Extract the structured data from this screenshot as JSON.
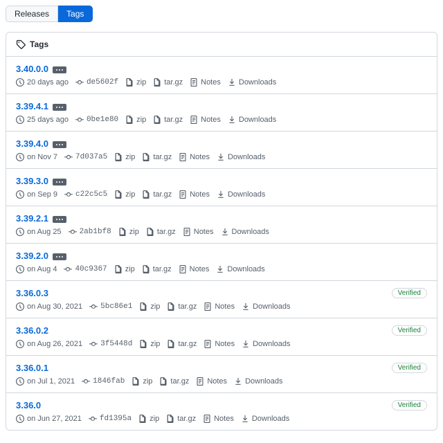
{
  "tabs": {
    "releases": "Releases",
    "tags": "Tags"
  },
  "panel_title": "Tags",
  "labels": {
    "zip": "zip",
    "targz": "tar.gz",
    "notes": "Notes",
    "downloads": "Downloads",
    "verified": "Verified"
  },
  "tags": [
    {
      "name": "3.40.0.0",
      "date": "20 days ago",
      "commit": "de5602f",
      "ellipsis": true,
      "verified": false
    },
    {
      "name": "3.39.4.1",
      "date": "25 days ago",
      "commit": "0be1e80",
      "ellipsis": true,
      "verified": false
    },
    {
      "name": "3.39.4.0",
      "date": "on Nov 7",
      "commit": "7d037a5",
      "ellipsis": true,
      "verified": false
    },
    {
      "name": "3.39.3.0",
      "date": "on Sep 9",
      "commit": "c22c5c5",
      "ellipsis": true,
      "verified": false
    },
    {
      "name": "3.39.2.1",
      "date": "on Aug 25",
      "commit": "2ab1bf8",
      "ellipsis": true,
      "verified": false
    },
    {
      "name": "3.39.2.0",
      "date": "on Aug 4",
      "commit": "40c9367",
      "ellipsis": true,
      "verified": false
    },
    {
      "name": "3.36.0.3",
      "date": "on Aug 30, 2021",
      "commit": "5bc86e1",
      "ellipsis": false,
      "verified": true
    },
    {
      "name": "3.36.0.2",
      "date": "on Aug 26, 2021",
      "commit": "3f5448d",
      "ellipsis": false,
      "verified": true
    },
    {
      "name": "3.36.0.1",
      "date": "on Jul 1, 2021",
      "commit": "1846fab",
      "ellipsis": false,
      "verified": true
    },
    {
      "name": "3.36.0",
      "date": "on Jun 27, 2021",
      "commit": "fd1395a",
      "ellipsis": false,
      "verified": true
    }
  ]
}
